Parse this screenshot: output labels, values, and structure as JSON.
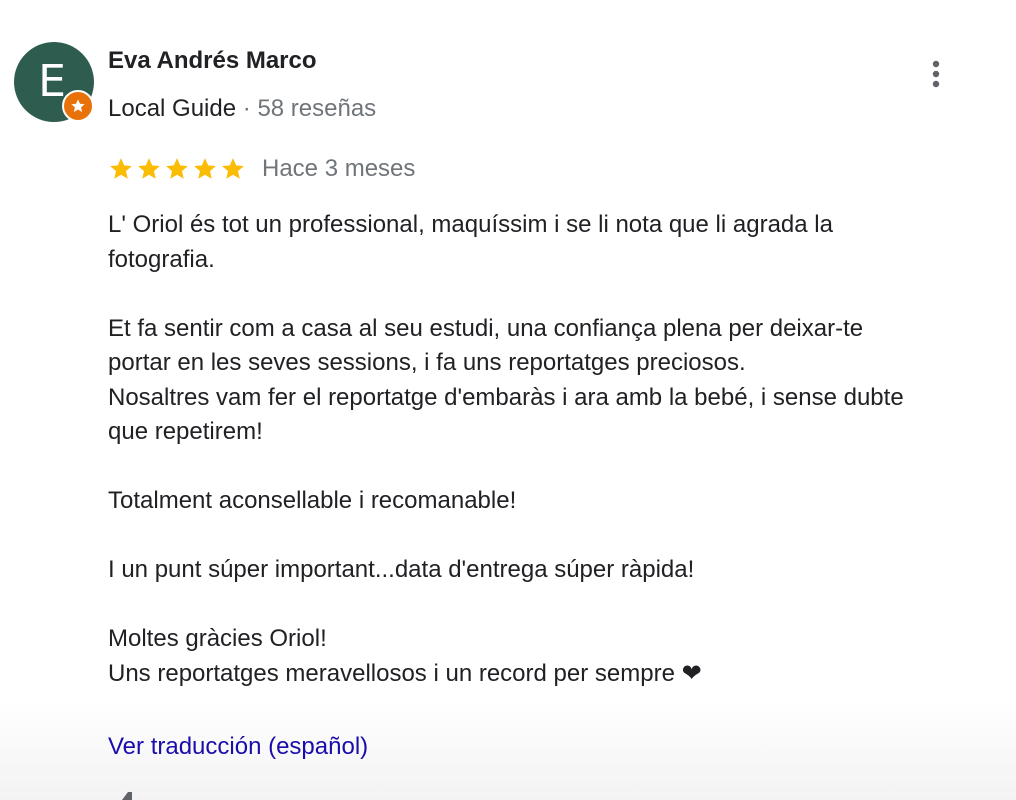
{
  "author": {
    "avatar_letter": "E",
    "avatar_color": "#2e5d50",
    "badge_color": "#e8710a",
    "name": "Eva Andrés Marco",
    "badge_label": "Local Guide",
    "separator": "·",
    "reviews_count": "58 reseñas"
  },
  "menu": {
    "icon": "more-vertical-icon"
  },
  "review": {
    "rating": 5,
    "rating_max": 5,
    "star_color": "#fbbc04",
    "time_ago": "Hace 3 meses",
    "paragraphs": [
      "L' Oriol és tot un professional, maquíssim i se li nota que li agrada la\nfotografia.",
      "Et fa sentir com a casa al seu estudi, una confiança plena per deixar-te\nportar en les seves sessions, i fa uns reportatges preciosos.\nNosaltres vam fer el reportatge d'embaràs i ara amb la bebé, i sense dubte\nque repetirem!",
      "Totalment aconsellable i recomanable!",
      "I un punt súper important...data d'entrega súper ràpida!",
      "Moltes gràcies Oriol!\nUns reportatges meravellosos i un record per sempre ❤"
    ],
    "translate_label": "Ver traducción (español)"
  }
}
